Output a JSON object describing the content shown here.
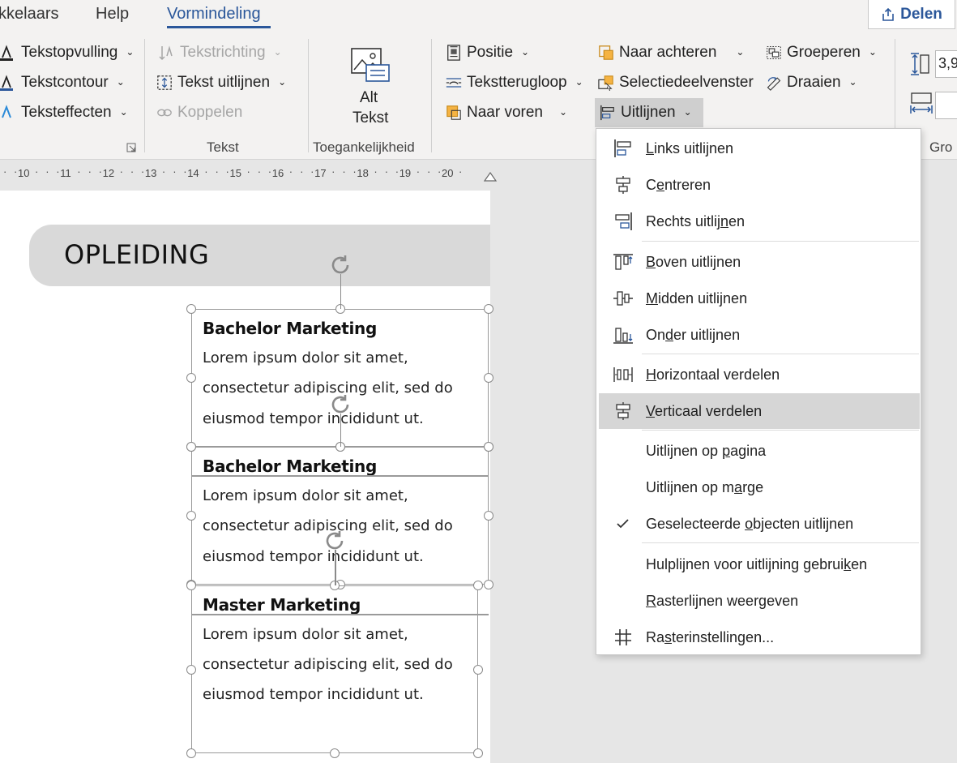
{
  "tabs": [
    {
      "label": "kkelaars"
    },
    {
      "label": "Help"
    },
    {
      "label": "Vormindeling",
      "active": true
    }
  ],
  "share_label": "Delen",
  "ribbon": {
    "text_group": {
      "fill": "Tekstopvulling",
      "contour": "Tekstcontour",
      "effects": "Teksteffecten"
    },
    "tekst_group": {
      "direction": "Tekstrichting",
      "align_text": "Tekst uitlijnen",
      "link": "Koppelen",
      "label": "Tekst"
    },
    "access_group": {
      "alt_line1": "Alt",
      "alt_line2": "Tekst",
      "label": "Toegankelijkheid"
    },
    "arrange_group": {
      "position": "Positie",
      "wrap": "Tekstterugloop",
      "forward": "Naar voren",
      "backward": "Naar achteren",
      "selection_pane": "Selectiedeelvenster",
      "align": "Uitlijnen",
      "group": "Groeperen",
      "rotate": "Draaien"
    },
    "size": {
      "height_value": "3,9",
      "group_label": "Gro"
    }
  },
  "ruler_ticks": [
    "10",
    "11",
    "12",
    "13",
    "14",
    "15",
    "16",
    "17",
    "18",
    "19",
    "20"
  ],
  "document": {
    "section_title": "OPLEIDING",
    "entries": [
      {
        "title": "Bachelor Marketing",
        "lines": [
          "Lorem ipsum dolor sit amet,",
          "consectetur adipiscing elit, sed do",
          "eiusmod tempor incididunt ut."
        ]
      },
      {
        "title": "Bachelor Marketing",
        "lines": [
          "Lorem ipsum dolor sit amet,",
          "consectetur adipiscing elit, sed do",
          "eiusmod tempor incididunt ut."
        ]
      },
      {
        "title": "Master Marketing",
        "lines": [
          "Lorem ipsum dolor sit amet,",
          "consectetur adipiscing elit, sed do",
          "eiusmod tempor incididunt ut."
        ]
      }
    ]
  },
  "align_menu": {
    "items": [
      {
        "pre": "",
        "key": "L",
        "post": "inks uitlijnen",
        "icon": "align-left-icon"
      },
      {
        "pre": "C",
        "key": "e",
        "post": "ntreren",
        "icon": "align-center-icon"
      },
      {
        "pre": "Rechts uitlij",
        "key": "n",
        "post": "en",
        "icon": "align-right-icon"
      },
      {
        "pre": "",
        "key": "B",
        "post": "oven uitlijnen",
        "icon": "align-top-icon"
      },
      {
        "pre": "",
        "key": "M",
        "post": "idden uitlijnen",
        "icon": "align-middle-icon"
      },
      {
        "pre": "On",
        "key": "d",
        "post": "er uitlijnen",
        "icon": "align-bottom-icon"
      },
      {
        "pre": "",
        "key": "H",
        "post": "orizontaal verdelen",
        "icon": "distribute-horizontal-icon"
      },
      {
        "pre": "",
        "key": "V",
        "post": "erticaal verdelen",
        "icon": "distribute-vertical-icon",
        "selected": true
      },
      {
        "pre": "Uitlijnen op ",
        "key": "p",
        "post": "agina",
        "icon": ""
      },
      {
        "pre": "Uitlijnen op m",
        "key": "a",
        "post": "rge",
        "icon": ""
      },
      {
        "pre": "Geselecteerde ",
        "key": "o",
        "post": "bjecten uitlijnen",
        "icon": "check-icon",
        "checked": true
      },
      {
        "pre": "Hulplijnen voor uitlijning gebrui",
        "key": "k",
        "post": "en",
        "icon": ""
      },
      {
        "pre": "",
        "key": "R",
        "post": "asterlijnen weergeven",
        "icon": ""
      },
      {
        "pre": "Ra",
        "key": "s",
        "post": "terinstellingen...",
        "icon": "grid-settings-icon"
      }
    ]
  },
  "colors": {
    "accent": "#2b579a",
    "menu_selected": "#d6d6d6",
    "banner": "#d9d9d9"
  }
}
